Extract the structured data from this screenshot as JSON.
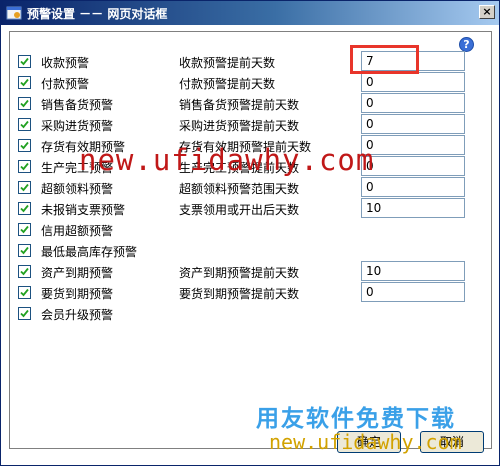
{
  "window": {
    "title": "预警设置 －－ 网页对话框",
    "close_glyph": "×"
  },
  "help_glyph": "?",
  "rows": [
    {
      "checked": true,
      "label": "收款预警",
      "setting": "收款预警提前天数",
      "value": "7"
    },
    {
      "checked": true,
      "label": "付款预警",
      "setting": "付款预警提前天数",
      "value": "0"
    },
    {
      "checked": true,
      "label": "销售备货预警",
      "setting": "销售备货预警提前天数",
      "value": "0"
    },
    {
      "checked": true,
      "label": "采购进货预警",
      "setting": "采购进货预警提前天数",
      "value": "0"
    },
    {
      "checked": true,
      "label": "存货有效期预警",
      "setting": "存货有效期预警提前天数",
      "value": "0"
    },
    {
      "checked": true,
      "label": "生产完工预警",
      "setting": "生产完工预警提前天数",
      "value": "0"
    },
    {
      "checked": true,
      "label": "超额领料预警",
      "setting": "超额领料预警范围天数",
      "value": "0"
    },
    {
      "checked": true,
      "label": "未报销支票预警",
      "setting": "支票领用或开出后天数",
      "value": "10"
    },
    {
      "checked": true,
      "label": "信用超额预警"
    },
    {
      "checked": true,
      "label": "最低最高库存预警"
    },
    {
      "checked": true,
      "label": "资产到期预警",
      "setting": "资产到期预警提前天数",
      "value": "10"
    },
    {
      "checked": true,
      "label": "要货到期预警",
      "setting": "要货到期预警提前天数",
      "value": "0"
    },
    {
      "checked": true,
      "label": "会员升级预警"
    }
  ],
  "buttons": {
    "ok": "确定",
    "cancel": "取消"
  },
  "watermarks": {
    "url_red": "new.ufidawhy.com",
    "brand_blue": "用友软件免费下载",
    "url_gold": "new.ufidawhy.com"
  },
  "colors": {
    "titlebar": "#0a246a",
    "highlight": "#e8352a",
    "watermark_red": "#c01818",
    "watermark_blue": "#3aa0e8",
    "watermark_gold": "#d2a200"
  }
}
